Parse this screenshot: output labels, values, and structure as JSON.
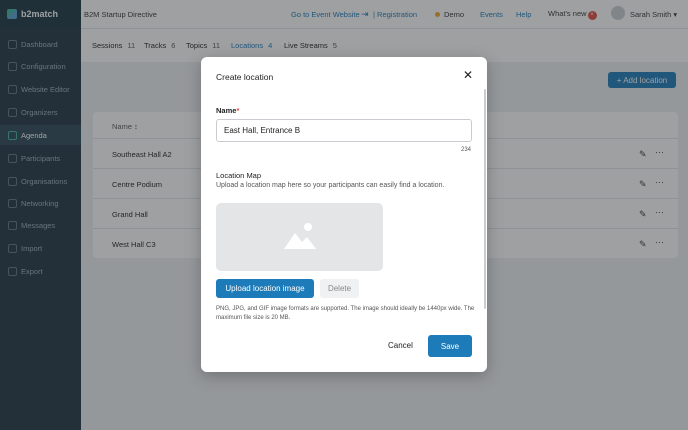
{
  "brand": {
    "name": "b2match"
  },
  "sidebar": {
    "items": [
      {
        "label": "Dashboard",
        "icon": "dashboard-icon"
      },
      {
        "label": "Configuration",
        "icon": "gear-icon"
      },
      {
        "label": "Website Editor",
        "icon": "editor-icon"
      },
      {
        "label": "Organizers",
        "icon": "users-icon"
      },
      {
        "label": "Agenda",
        "icon": "calendar-icon"
      },
      {
        "label": "Participants",
        "icon": "participants-icon"
      },
      {
        "label": "Organisations",
        "icon": "building-icon"
      },
      {
        "label": "Networking",
        "icon": "networking-icon"
      },
      {
        "label": "Messages",
        "icon": "mail-icon"
      },
      {
        "label": "Import",
        "icon": "import-icon"
      },
      {
        "label": "Export",
        "icon": "export-icon"
      }
    ],
    "active": "Agenda"
  },
  "topbar": {
    "event_name": "B2M Startup Directive",
    "go_to_event": "Go to Event Website",
    "registration": "| Registration",
    "demo": "Demo",
    "events": "Events",
    "help": "Help",
    "whats_new": "What's new",
    "whats_new_badge": "×",
    "user_name": "Sarah Smith"
  },
  "tabs": [
    {
      "label": "Sessions",
      "count": "11"
    },
    {
      "label": "Tracks",
      "count": "6"
    },
    {
      "label": "Topics",
      "count": "11"
    },
    {
      "label": "Locations",
      "count": "4"
    },
    {
      "label": "Live Streams",
      "count": "5"
    }
  ],
  "active_tab": "Locations",
  "add_button": "+ Add location",
  "table": {
    "header": "Name ↕",
    "rows": [
      "Southeast Hall A2",
      "Centre Podium",
      "Grand Hall",
      "West Hall C3"
    ]
  },
  "modal": {
    "title": "Create location",
    "name_label": "Name",
    "required_mark": "*",
    "name_value": "East Hall, Entrance B",
    "char_counter": "234",
    "map_title": "Location Map",
    "map_hint": "Upload a location map here so your participants can easily find a location.",
    "upload_button": "Upload location image",
    "delete_button": "Delete",
    "formats_note": "PNG, JPG, and GIF image formats are supported. The image should ideally be 1440px wide. The maximum file size is 20 MB.",
    "cancel_button": "Cancel",
    "save_button": "Save"
  },
  "colors": {
    "accent": "#1c7bb8",
    "sidebar": "#1f3440",
    "demo_dot": "#f5a623",
    "badge": "#e04a3f"
  }
}
